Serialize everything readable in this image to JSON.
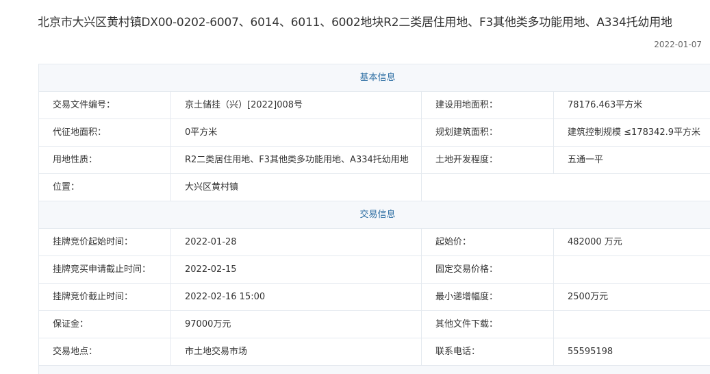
{
  "title": "北京市大兴区黄村镇DX00-0202-6007、6014、6011、6002地块R2二类居住用地、F3其他类多功能用地、A334托幼用地",
  "date": "2022-01-07",
  "sections": {
    "basic": "基本信息",
    "trade": "交易信息"
  },
  "basic_rows": [
    [
      "交易文件编号：",
      "京土储挂（兴）[2022]008号",
      "建设用地面积：",
      "78176.463平方米"
    ],
    [
      "代征地面积：",
      "0平方米",
      "规划建筑面积：",
      "建筑控制规模 ≤178342.9平方米"
    ],
    [
      "用地性质：",
      "R2二类居住用地、F3其他类多功能用地、A334托幼用地",
      "土地开发程度：",
      "五通一平"
    ],
    [
      "位置：",
      "大兴区黄村镇"
    ]
  ],
  "trade_rows": [
    [
      "挂牌竞价起始时间：",
      "2022-01-28",
      "起始价：",
      "482000 万元"
    ],
    [
      "挂牌竞买申请截止时间：",
      "2022-02-15",
      "固定交易价格：",
      ""
    ],
    [
      "挂牌竞价截止时间：",
      "2022-02-16 15:00",
      "最小递增幅度：",
      "2500万元"
    ],
    [
      "保证金：",
      "97000万元",
      "其他文件下载：",
      ""
    ],
    [
      "交易地点：",
      "市土地交易市场",
      "联系电话：",
      "55595198"
    ]
  ]
}
